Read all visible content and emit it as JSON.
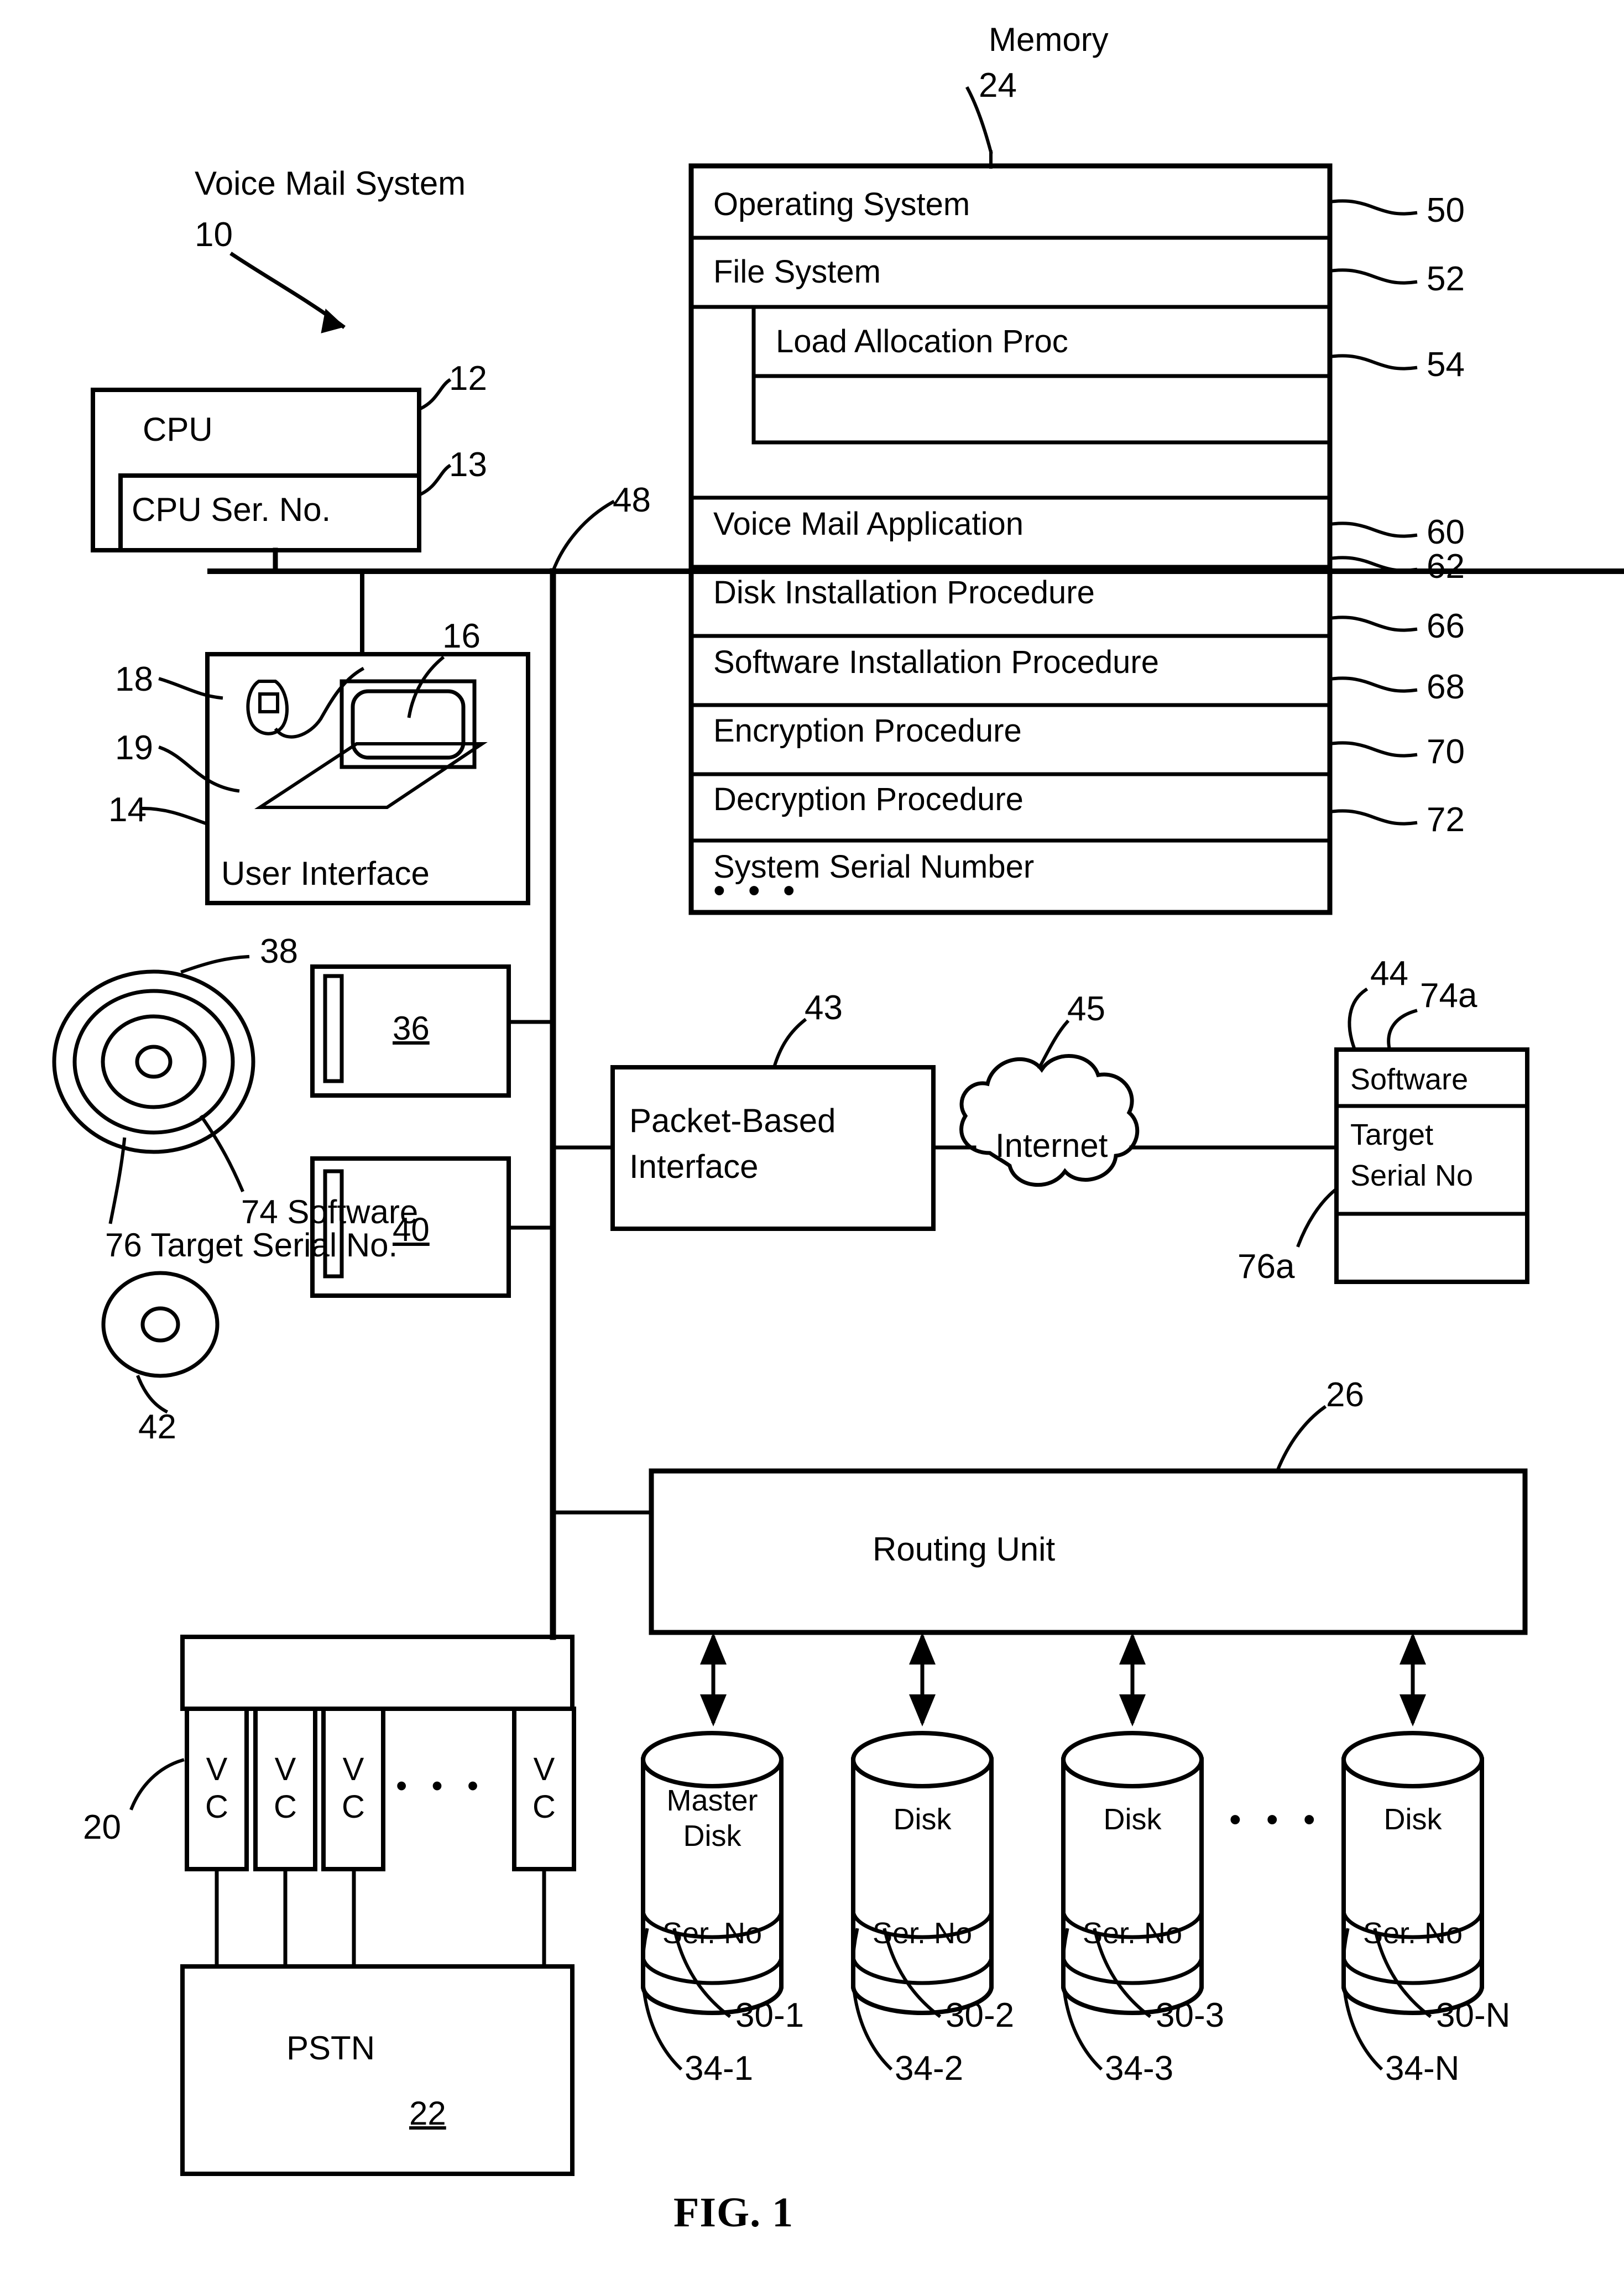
{
  "figure": {
    "caption": "FIG. 1",
    "system_title": "Voice Mail System",
    "system_ref": "10",
    "memory_title": "Memory",
    "memory_ref": "24"
  },
  "memory": {
    "rows": [
      {
        "label": "Operating System",
        "ref": "50"
      },
      {
        "label": "File System",
        "ref": "52"
      },
      {
        "label": "Load Allocation Proc",
        "ref": "54"
      },
      {
        "label": "",
        "ref": ""
      },
      {
        "label": "Voice Mail Application",
        "ref": "60"
      },
      {
        "label": "Disk Installation Procedure",
        "ref": "62"
      },
      {
        "label": "Software Installation Procedure",
        "ref": "66"
      },
      {
        "label": "Encryption Procedure",
        "ref": "68"
      },
      {
        "label": "Decryption Procedure",
        "ref": "70"
      },
      {
        "label": "System Serial Number",
        "ref": "72"
      },
      {
        "label": "• • •",
        "ref": ""
      }
    ]
  },
  "cpu": {
    "label": "CPU",
    "ref": "12",
    "serial_label": "CPU Ser. No.",
    "serial_ref": "13"
  },
  "bus": {
    "ref": "48"
  },
  "user_interface": {
    "label": "User Interface",
    "ref": "14",
    "monitor_ref": "16",
    "mouse_ref": "18",
    "keyboard_ref": "19"
  },
  "drives": {
    "drive_a_ref": "36",
    "media_a_ref": "38",
    "drive_b_ref": "40",
    "media_b_ref": "42",
    "software_note": "74 Software",
    "target_serial_note": "76 Target Serial No."
  },
  "network": {
    "packet_interface_line1": "Packet-Based",
    "packet_interface_line2": "Interface",
    "packet_interface_ref": "43",
    "internet_label": "Internet",
    "internet_ref": "45",
    "remote_ref": "44",
    "remote_software_label": "Software",
    "remote_software_ref": "74a",
    "remote_target_line1": "Target",
    "remote_target_line2": "Serial No",
    "remote_target_ref": "76a"
  },
  "routing": {
    "label": "Routing Unit",
    "ref": "26"
  },
  "disks": [
    {
      "name_line1": "Master",
      "name_line2": "Disk",
      "serial_label": "Ser. No",
      "ref_disk": "30-1",
      "ref_serial": "34-1"
    },
    {
      "name_line1": "Disk",
      "name_line2": "",
      "serial_label": "Ser. No",
      "ref_disk": "30-2",
      "ref_serial": "34-2"
    },
    {
      "name_line1": "Disk",
      "name_line2": "",
      "serial_label": "Ser. No",
      "ref_disk": "30-3",
      "ref_serial": "34-3"
    },
    {
      "name_line1": "Disk",
      "name_line2": "",
      "serial_label": "Ser. No",
      "ref_disk": "30-N",
      "ref_serial": "34-N"
    }
  ],
  "disks_ellipsis": "• • •",
  "telephony": {
    "vc_label_line1": "V",
    "vc_label_line2": "C",
    "vc_group_ref": "20",
    "vc_ellipsis": "• • •",
    "pstn_label": "PSTN",
    "pstn_ref": "22"
  }
}
